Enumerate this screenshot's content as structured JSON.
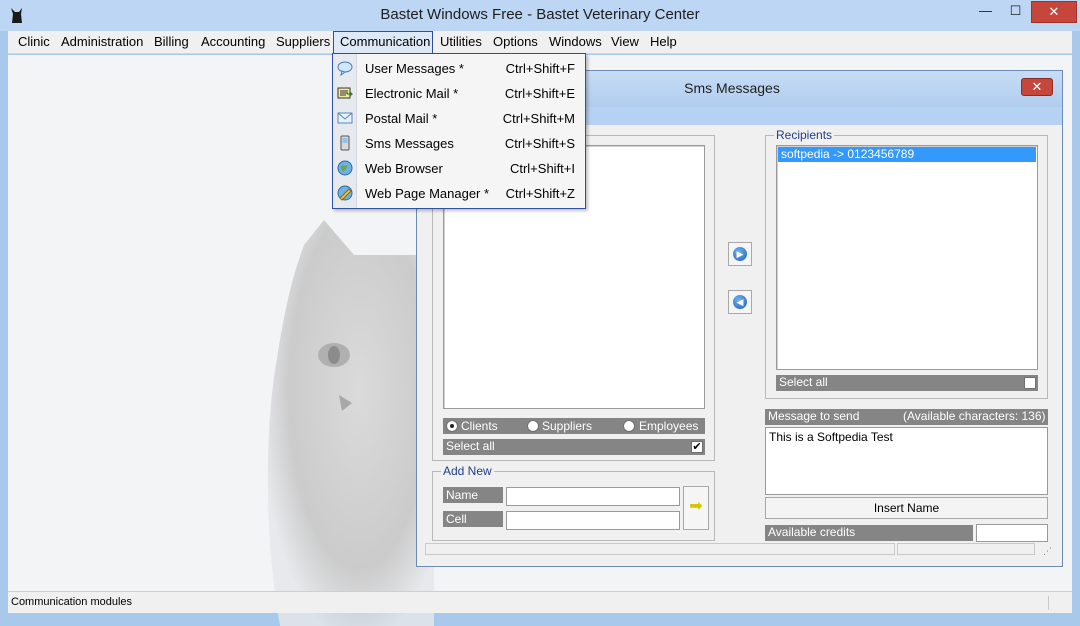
{
  "window": {
    "title": "Bastet Windows Free - Bastet Veterinary Center",
    "app_icon": "cat-icon",
    "minimize_glyph": "—",
    "maximize_glyph": "☐",
    "close_glyph": "✕"
  },
  "menubar": {
    "items": [
      "Clinic",
      "Administration",
      "Billing",
      "Accounting",
      "Suppliers",
      "Communication",
      "Utilities",
      "Options",
      "Windows",
      "View",
      "Help"
    ],
    "active": "Communication"
  },
  "communication_menu": {
    "items": [
      {
        "label": "User Messages *",
        "shortcut": "Ctrl+Shift+F",
        "icon": "speech-bubble-icon"
      },
      {
        "label": "Electronic Mail *",
        "shortcut": "Ctrl+Shift+E",
        "icon": "email-icon"
      },
      {
        "label": "Postal Mail *",
        "shortcut": "Ctrl+Shift+M",
        "icon": "envelope-icon"
      },
      {
        "label": "Sms Messages",
        "shortcut": "Ctrl+Shift+S",
        "icon": "mobile-phone-icon"
      },
      {
        "label": "Web Browser",
        "shortcut": "Ctrl+Shift+I",
        "icon": "globe-icon"
      },
      {
        "label": "Web Page Manager *",
        "shortcut": "Ctrl+Shift+Z",
        "icon": "web-page-icon"
      }
    ]
  },
  "sms_window": {
    "title": "Sms Messages",
    "close_glyph": "✕",
    "contacts": {
      "radio_options": [
        "Clients",
        "Suppliers",
        "Employees"
      ],
      "selected_option": "Clients",
      "select_all_label": "Select all",
      "select_all_checked": "✔"
    },
    "add_new": {
      "group_label": "Add New",
      "name_label": "Name",
      "cell_label": "Cell",
      "name_value": "",
      "cell_value": "",
      "add_glyph": "➡"
    },
    "recipients": {
      "group_label": "Recipients",
      "items": [
        "softpedia -> 0123456789"
      ],
      "select_all_label": "Select all"
    },
    "message": {
      "label": "Message to send",
      "available_chars": "(Available characters: 136)",
      "text": "This is a Softpedia Test",
      "insert_name_label": "Insert Name"
    },
    "credits": {
      "label": "Available credits",
      "value": ""
    },
    "buttons": {
      "add_glyph": "▶",
      "remove_glyph": "◀"
    }
  },
  "statusbar": {
    "text": "Communication modules"
  }
}
